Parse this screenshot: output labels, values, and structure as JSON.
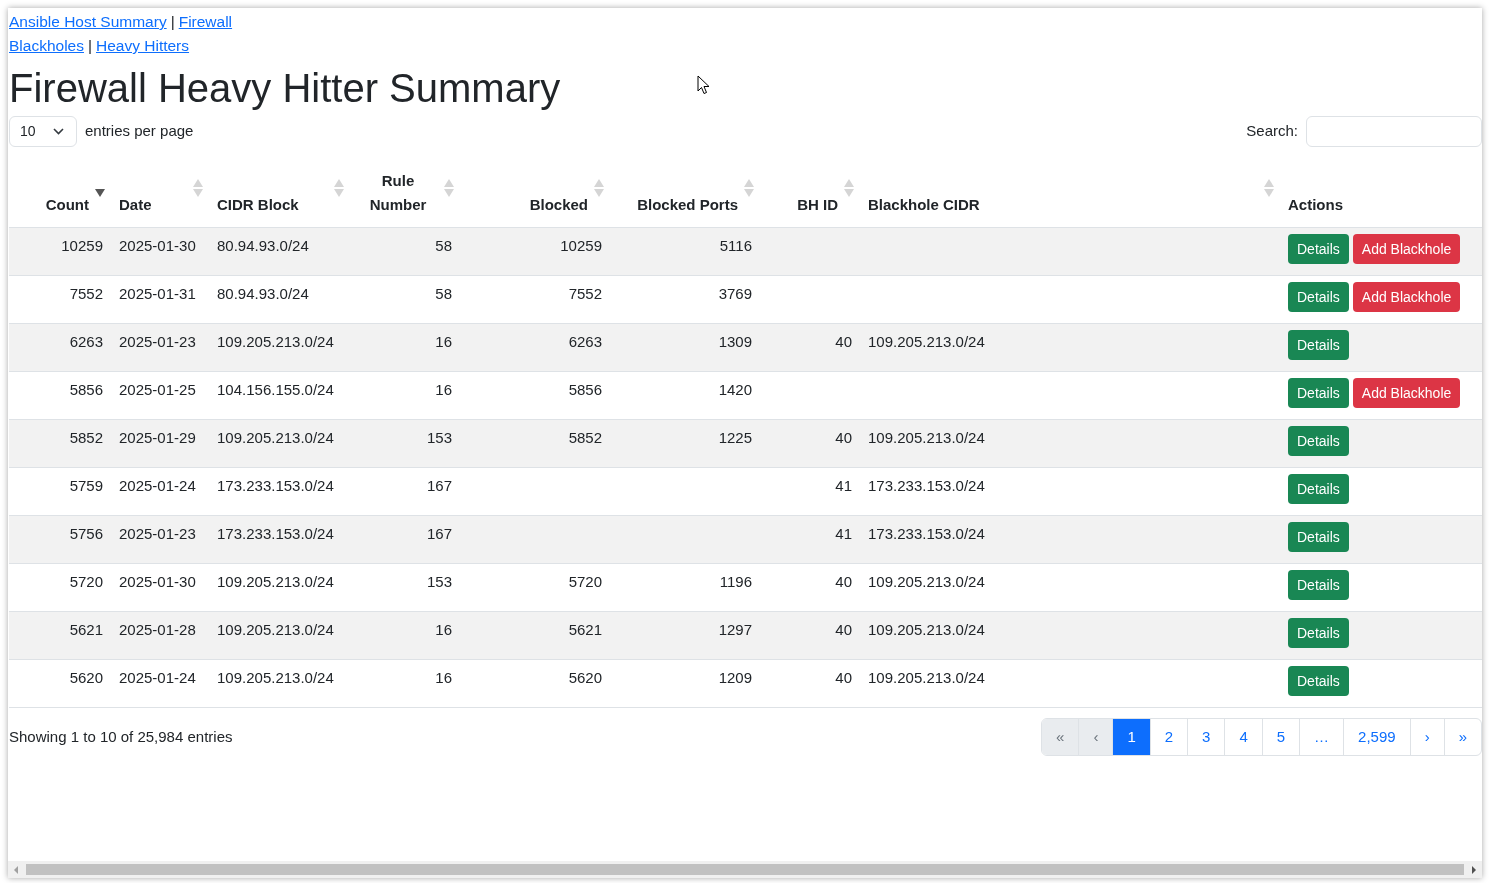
{
  "nav_links": [
    {
      "links": [
        "Ansible Host Summary",
        "Firewall"
      ],
      "separator": "|"
    },
    {
      "links": [
        "Blackholes",
        "Heavy Hitters"
      ],
      "separator": "|"
    }
  ],
  "title": "Firewall Heavy Hitter Summary",
  "page_length": {
    "value": "10",
    "label": "entries per page"
  },
  "search": {
    "label": "Search:"
  },
  "table": {
    "columns": [
      {
        "label": "Count",
        "sortable": true,
        "sorted": true,
        "numeric": true
      },
      {
        "label": "Date",
        "sortable": true,
        "sorted": false,
        "numeric": false
      },
      {
        "label": "CIDR Block",
        "sortable": true,
        "sorted": false,
        "numeric": false
      },
      {
        "label": "Rule Number",
        "sortable": true,
        "sorted": false,
        "numeric": true
      },
      {
        "label": "Blocked",
        "sortable": true,
        "sorted": false,
        "numeric": true
      },
      {
        "label": "Blocked Ports",
        "sortable": true,
        "sorted": false,
        "numeric": true
      },
      {
        "label": "BH ID",
        "sortable": true,
        "sorted": false,
        "numeric": true
      },
      {
        "label": "Blackhole CIDR",
        "sortable": true,
        "sorted": false,
        "numeric": false
      },
      {
        "label": "Actions",
        "sortable": false,
        "numeric": false
      }
    ],
    "rows": [
      {
        "cells": [
          "10259",
          "2025-01-30",
          "80.94.93.0/24",
          "58",
          "10259",
          "5116",
          "",
          ""
        ],
        "actions": [
          {
            "kind": "details",
            "label": "Details"
          },
          {
            "kind": "blackhole",
            "label": "Add Blackhole"
          }
        ]
      },
      {
        "cells": [
          "7552",
          "2025-01-31",
          "80.94.93.0/24",
          "58",
          "7552",
          "3769",
          "",
          ""
        ],
        "actions": [
          {
            "kind": "details",
            "label": "Details"
          },
          {
            "kind": "blackhole",
            "label": "Add Blackhole"
          }
        ]
      },
      {
        "cells": [
          "6263",
          "2025-01-23",
          "109.205.213.0/24",
          "16",
          "6263",
          "1309",
          "40",
          "109.205.213.0/24"
        ],
        "actions": [
          {
            "kind": "details",
            "label": "Details"
          }
        ]
      },
      {
        "cells": [
          "5856",
          "2025-01-25",
          "104.156.155.0/24",
          "16",
          "5856",
          "1420",
          "",
          ""
        ],
        "actions": [
          {
            "kind": "details",
            "label": "Details"
          },
          {
            "kind": "blackhole",
            "label": "Add Blackhole"
          }
        ]
      },
      {
        "cells": [
          "5852",
          "2025-01-29",
          "109.205.213.0/24",
          "153",
          "5852",
          "1225",
          "40",
          "109.205.213.0/24"
        ],
        "actions": [
          {
            "kind": "details",
            "label": "Details"
          }
        ]
      },
      {
        "cells": [
          "5759",
          "2025-01-24",
          "173.233.153.0/24",
          "167",
          "",
          "",
          "41",
          "173.233.153.0/24"
        ],
        "actions": [
          {
            "kind": "details",
            "label": "Details"
          }
        ]
      },
      {
        "cells": [
          "5756",
          "2025-01-23",
          "173.233.153.0/24",
          "167",
          "",
          "",
          "41",
          "173.233.153.0/24"
        ],
        "actions": [
          {
            "kind": "details",
            "label": "Details"
          }
        ]
      },
      {
        "cells": [
          "5720",
          "2025-01-30",
          "109.205.213.0/24",
          "153",
          "5720",
          "1196",
          "40",
          "109.205.213.0/24"
        ],
        "actions": [
          {
            "kind": "details",
            "label": "Details"
          }
        ]
      },
      {
        "cells": [
          "5621",
          "2025-01-28",
          "109.205.213.0/24",
          "16",
          "5621",
          "1297",
          "40",
          "109.205.213.0/24"
        ],
        "actions": [
          {
            "kind": "details",
            "label": "Details"
          }
        ]
      },
      {
        "cells": [
          "5620",
          "2025-01-24",
          "109.205.213.0/24",
          "16",
          "5620",
          "1209",
          "40",
          "109.205.213.0/24"
        ],
        "actions": [
          {
            "kind": "details",
            "label": "Details"
          }
        ]
      }
    ]
  },
  "info": "Showing 1 to 10 of 25,984 entries",
  "pagination": [
    {
      "label": "«",
      "selected": false,
      "disabled": true
    },
    {
      "label": "‹",
      "selected": false,
      "disabled": true
    },
    {
      "label": "1",
      "selected": true,
      "disabled": false
    },
    {
      "label": "2",
      "selected": false,
      "disabled": false
    },
    {
      "label": "3",
      "selected": false,
      "disabled": false
    },
    {
      "label": "4",
      "selected": false,
      "disabled": false
    },
    {
      "label": "5",
      "selected": false,
      "disabled": false
    },
    {
      "label": "…",
      "selected": false,
      "disabled": false
    },
    {
      "label": "2,599",
      "selected": false,
      "disabled": false
    },
    {
      "label": "›",
      "selected": false,
      "disabled": false
    },
    {
      "label": "»",
      "selected": false,
      "disabled": false
    }
  ]
}
